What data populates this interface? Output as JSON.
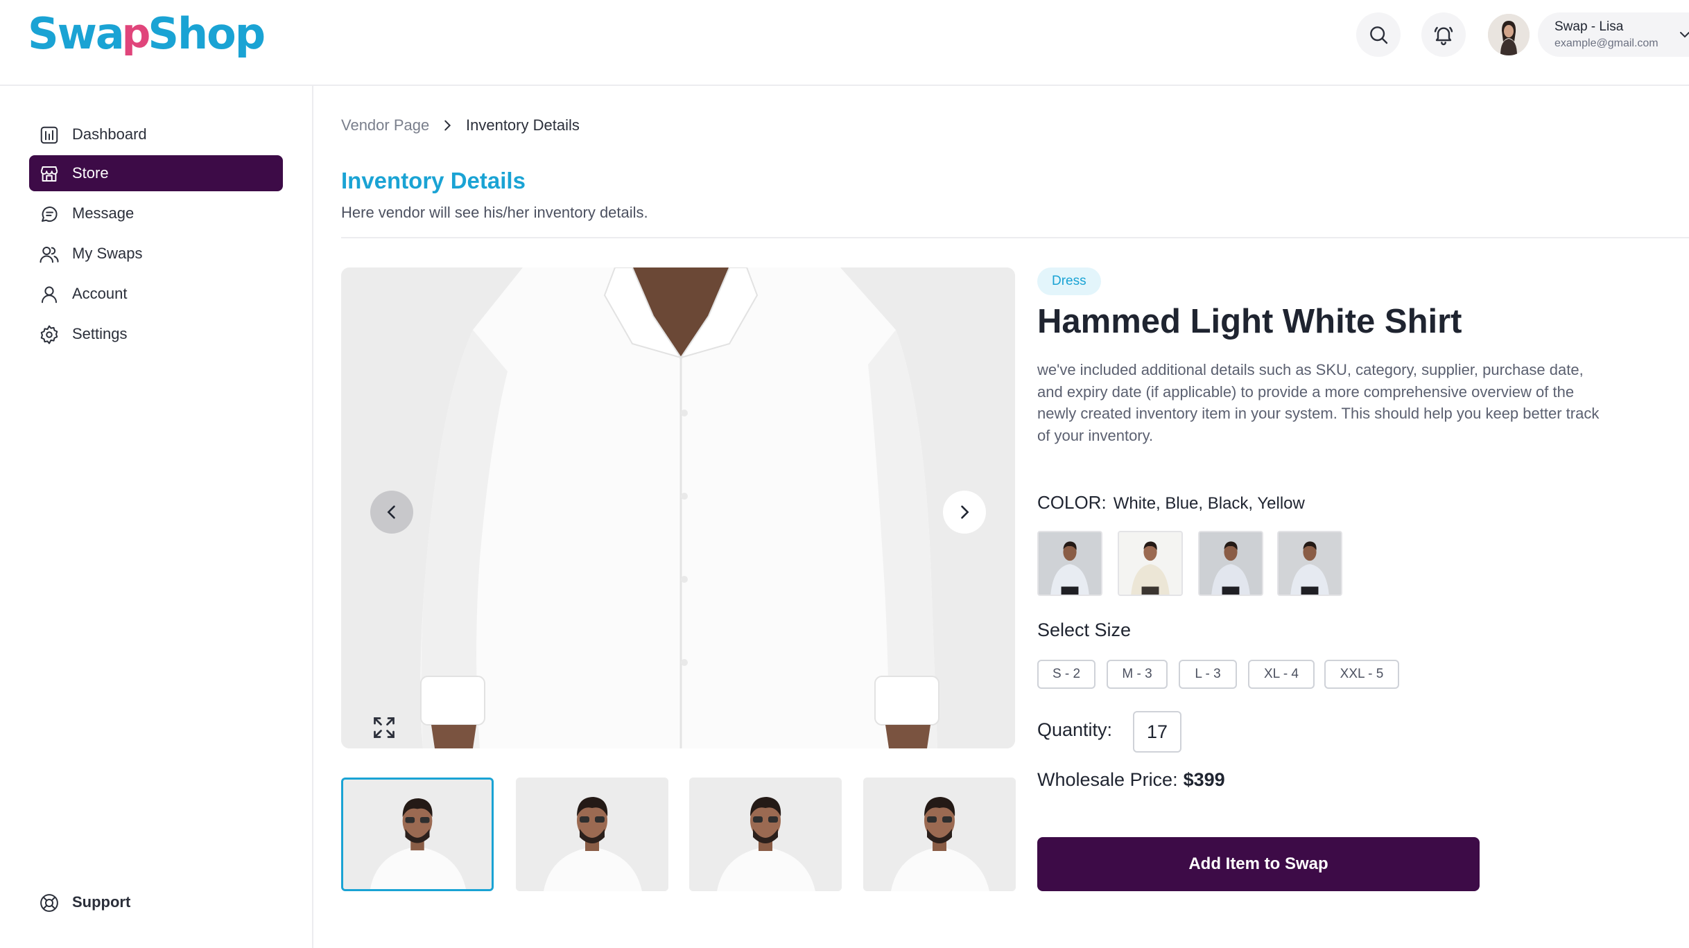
{
  "app": {
    "logo_part1": "Swa",
    "logo_part2": "p",
    "logo_part3": "Shop"
  },
  "header": {
    "user_name": "Swap - Lisa",
    "user_email": "example@gmail.com",
    "icons": [
      "search-icon",
      "bell-icon",
      "chevron-down-icon"
    ]
  },
  "sidebar": {
    "items": [
      {
        "label": "Dashboard",
        "icon": "chart-icon"
      },
      {
        "label": "Store",
        "icon": "store-icon",
        "active": true
      },
      {
        "label": "Message",
        "icon": "message-icon"
      },
      {
        "label": "My Swaps",
        "icon": "users-icon"
      },
      {
        "label": "Account",
        "icon": "user-icon"
      },
      {
        "label": "Settings",
        "icon": "gear-icon"
      }
    ],
    "support_label": "Support"
  },
  "breadcrumb": {
    "parent": "Vendor Page",
    "current": "Inventory Details"
  },
  "page": {
    "title": "Inventory Details",
    "subtitle": "Here vendor will see his/her inventory details."
  },
  "product": {
    "category": "Dress",
    "name": "Hammed Light White Shirt",
    "description": "we've included additional details such as SKU, category, supplier, purchase date, and expiry date (if applicable) to provide a more comprehensive overview of the newly created inventory item in your system. This should help you keep better track of your inventory.",
    "color_label": "COLOR:",
    "colors": "White, Blue, Black, Yellow",
    "size_title": "Select Size",
    "sizes": [
      "S - 2",
      "M - 3",
      "L - 3",
      "XL - 4",
      "XXL - 5"
    ],
    "quantity_label": "Quantity:",
    "quantity": "17",
    "price_label": "Wholesale Price:",
    "price": "$399",
    "cta_label": "Add Item to Swap"
  },
  "colors": {
    "brand_purple": "#3d0b47",
    "brand_blue": "#1aa3d4",
    "brand_pink": "#e0457b"
  }
}
